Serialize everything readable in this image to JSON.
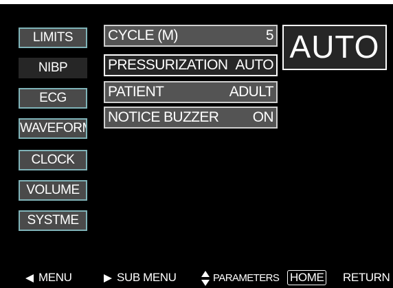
{
  "menu": {
    "items": [
      {
        "label": "LIMITS"
      },
      {
        "label": "NIBP"
      },
      {
        "label": "ECG"
      },
      {
        "label": "WAVEFORM"
      },
      {
        "label": "CLOCK"
      },
      {
        "label": "VOLUME"
      },
      {
        "label": "SYSTME"
      }
    ],
    "selected_index": 1
  },
  "parameters": [
    {
      "name": "CYCLE (M)",
      "value": "5"
    },
    {
      "name": "PRESSURIZATION",
      "value": "AUTO"
    },
    {
      "name": "PATIENT",
      "value": "ADULT"
    },
    {
      "name": "NOTICE BUZZER",
      "value": "ON"
    }
  ],
  "mode": {
    "label": "AUTO"
  },
  "help_bar": {
    "menu_label": "MENU",
    "sub_menu_label": "SUB MENU",
    "parameters_label": "PARAMETERS",
    "home_label": "HOME",
    "return_label": "RETURN",
    "icons": {
      "menu": "triangle-left-icon",
      "sub_menu": "triangle-right-icon",
      "parameters": "up-down-triangle-icon"
    }
  },
  "colors": {
    "background": "#000000",
    "item_fill": "#4a4a4a",
    "selected_fill": "#262626",
    "menu_border": "#7fb3b8",
    "param_border": "#d0d0d0",
    "text": "#ffffff"
  }
}
